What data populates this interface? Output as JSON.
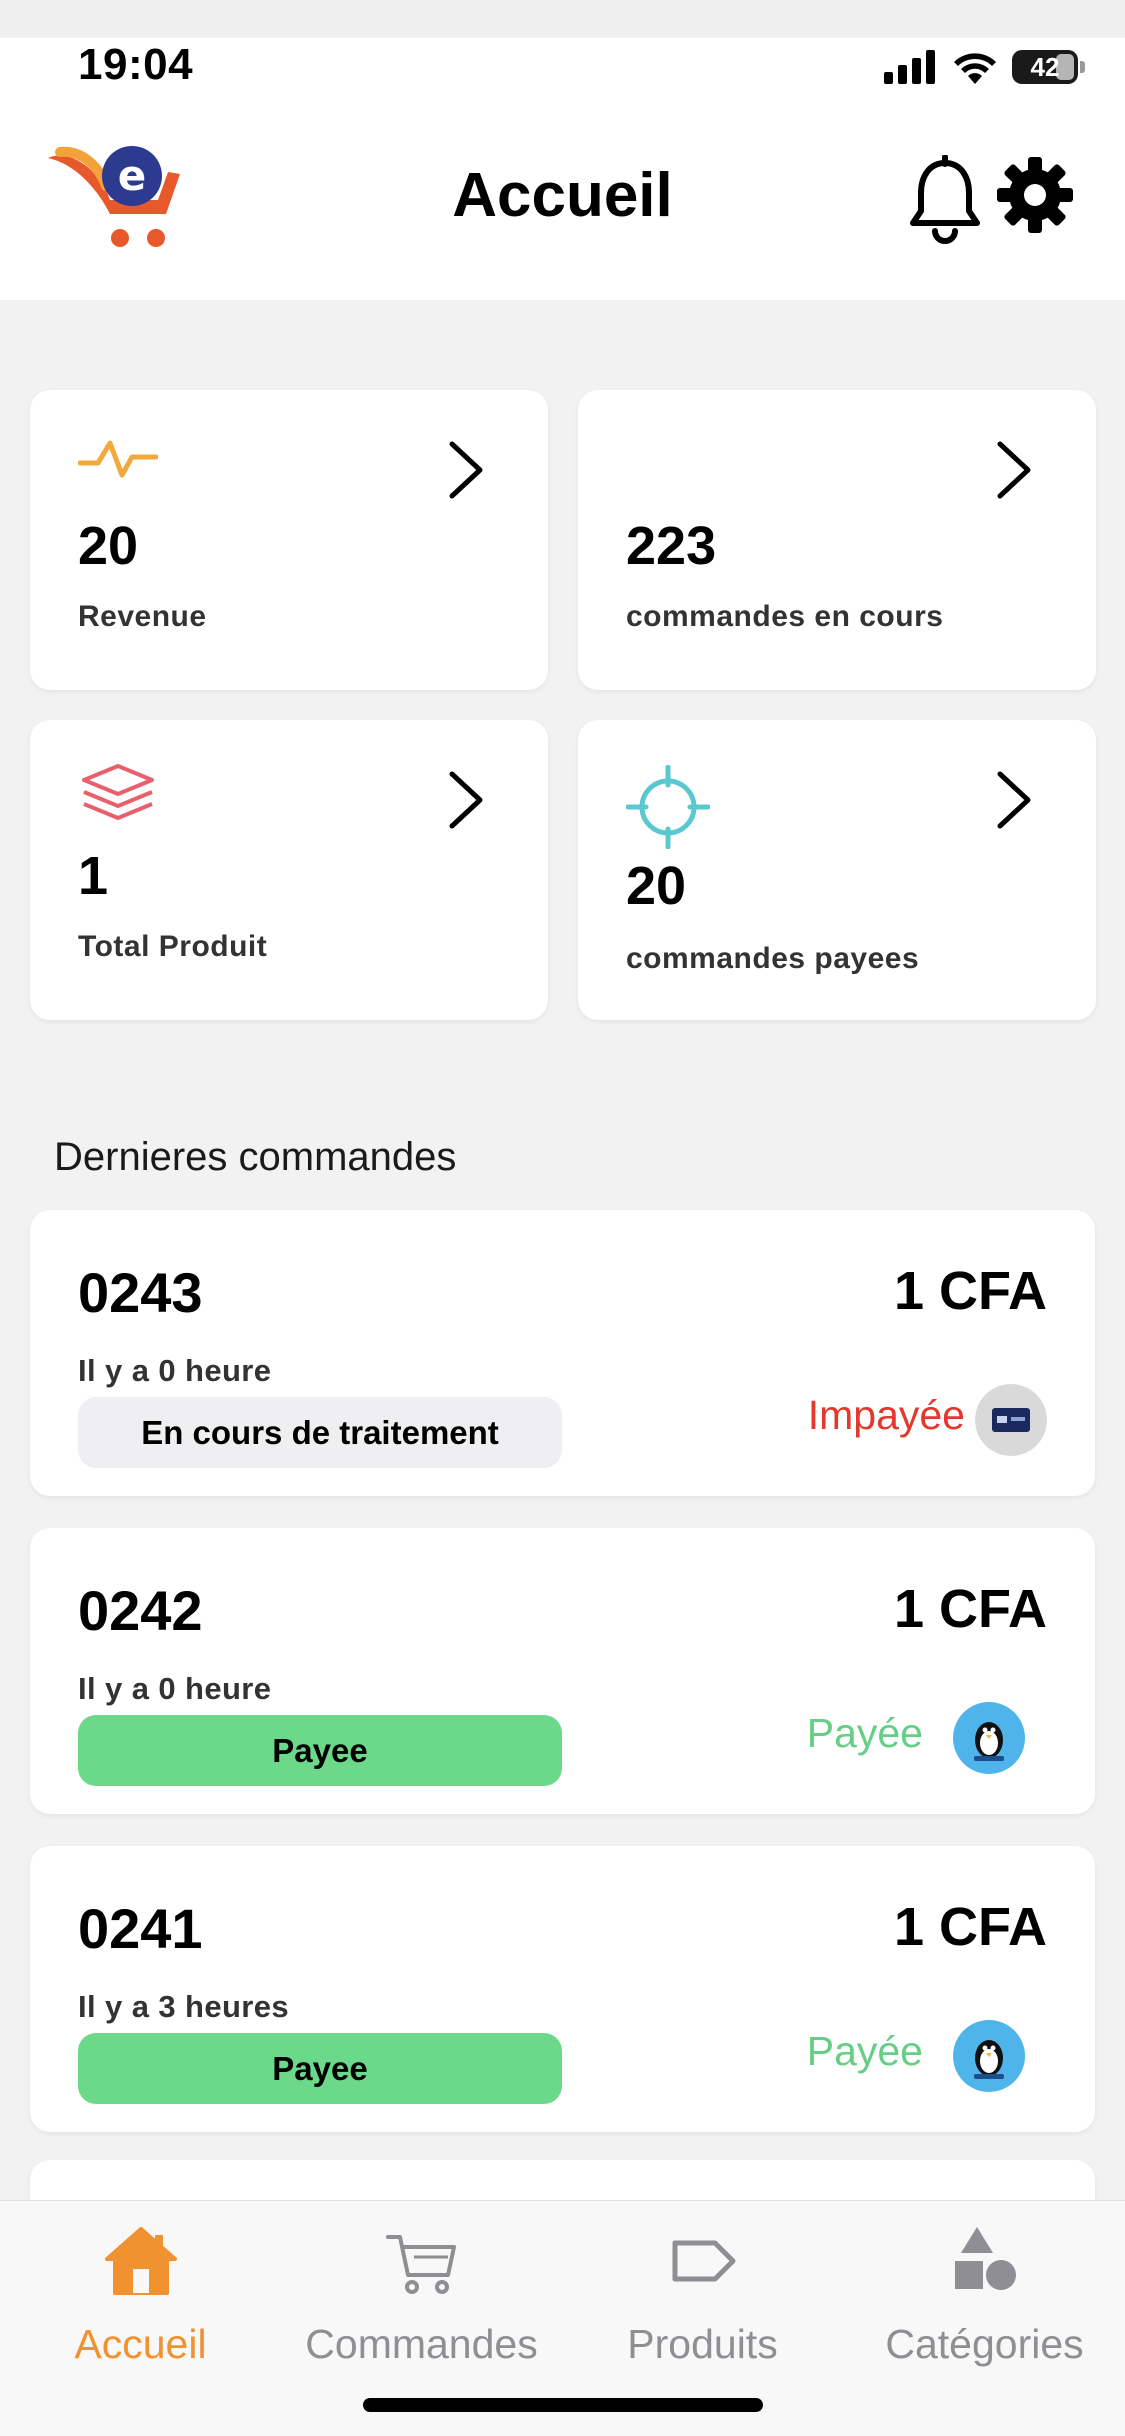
{
  "status_bar": {
    "time": "19:04",
    "battery": "42"
  },
  "header": {
    "title": "Accueil"
  },
  "stats": [
    {
      "value": "20",
      "label": "Revenue",
      "icon": "pulse-icon"
    },
    {
      "value": "223",
      "label": "commandes en cours",
      "icon": ""
    },
    {
      "value": "1",
      "label": "Total Produit",
      "icon": "layers-icon"
    },
    {
      "value": "20",
      "label": "commandes payees",
      "icon": "crosshair-icon"
    }
  ],
  "recent_orders": {
    "title": "Dernieres commandes",
    "items": [
      {
        "number": "0243",
        "amount": "1 CFA",
        "time": "Il y a 0 heure",
        "status": "En cours de traitement",
        "payment_status": "Impayée",
        "payment_method_icon": "card-icon"
      },
      {
        "number": "0242",
        "amount": "1 CFA",
        "time": "Il y a 0 heure",
        "status": "Payee",
        "payment_status": "Payée",
        "payment_method_icon": "wave-icon"
      },
      {
        "number": "0241",
        "amount": "1 CFA",
        "time": "Il y a 3 heures",
        "status": "Payee",
        "payment_status": "Payée",
        "payment_method_icon": "wave-icon"
      }
    ]
  },
  "tabs": [
    {
      "label": "Accueil",
      "icon": "home-icon",
      "active": true
    },
    {
      "label": "Commandes",
      "icon": "cart-icon",
      "active": false
    },
    {
      "label": "Produits",
      "icon": "tag-icon",
      "active": false
    },
    {
      "label": "Catégories",
      "icon": "shapes-icon",
      "active": false
    }
  ],
  "colors": {
    "accent": "#f0922f",
    "paid_green": "#6bd88a",
    "unpaid_red": "#e2382d",
    "revenue_icon": "#f2a93b",
    "products_icon": "#e7616c",
    "paid_icon": "#5ac8d0"
  }
}
